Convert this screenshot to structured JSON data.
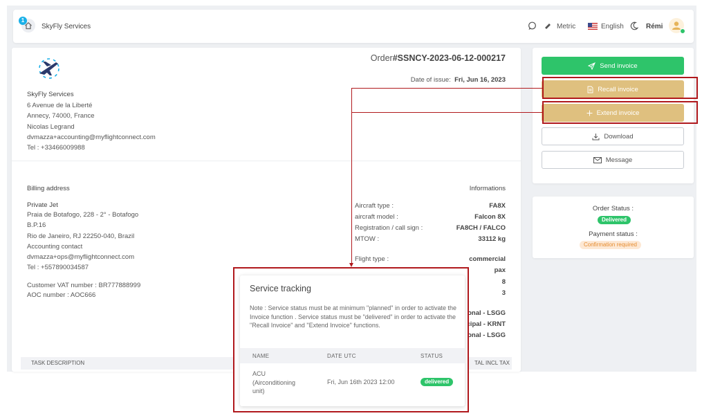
{
  "header": {
    "notification_count": "1",
    "brand": "SkyFly Services",
    "units": "Metric",
    "language": "English",
    "user": "Rémi"
  },
  "order": {
    "prefix": "Order",
    "number": "#SSNCY-2023-06-12-000217",
    "date_label": "Date of issue:",
    "date_value": "Fri, Jun 16, 2023"
  },
  "supplier": {
    "lines": [
      "SkyFly Services",
      "6 Avenue de la Liberté",
      "Annecy,  74000,  France",
      "Nicolas Legrand",
      "dvmazza+accounting@myflightconnect.com",
      "Tel : +33466009988"
    ]
  },
  "billing": {
    "heading": "Billing address",
    "lines": [
      "Private Jet",
      "Praia de Botafogo, 228 - 2° - Botafogo",
      "B.P.16",
      "Rio de Janeiro,  RJ 22250-040,  Brazil",
      "Accounting contact",
      "dvmazza+ops@myflightconnect.com",
      "Tel : +557890034587"
    ],
    "vat": "Customer VAT number : BR777888999",
    "aoc": "AOC number : AOC666"
  },
  "informations": {
    "heading": "Informations",
    "rows": [
      {
        "label": "Aircraft type :",
        "value": "FA8X"
      },
      {
        "label": "aircraft model :",
        "value": "Falcon 8X"
      },
      {
        "label": "Registration / call sign :",
        "value": "FA8CH / FALCO"
      },
      {
        "label": "MTOW :",
        "value": "33112 kg"
      },
      {
        "label": "Flight type :",
        "value": "commercial"
      }
    ],
    "partial_values": [
      "pax",
      "8",
      "3",
      "onal - LSGG",
      "cipal - KRNT",
      "onal - LSGG"
    ]
  },
  "table": {
    "col_task": "TASK DESCRIPTION",
    "col_total": "TAL INCL TAX"
  },
  "actions": {
    "send": "Send invoice",
    "recall": "Recall invoice",
    "extend": "Extend invoice",
    "download": "Download",
    "message": "Message"
  },
  "status": {
    "order_label": "Order Status :",
    "order_value": "Delivered",
    "payment_label": "Payment status :",
    "payment_value": "Confirmation required"
  },
  "popup": {
    "title": "Service tracking",
    "note": "Note : Service status must be at minimum \"planned\" in order to activate the Invoice function . Service status must be \"delivered\" in order to activate the \"Recall Invoice\" and \"Extend Invoice\" functions.",
    "columns": [
      "NAME",
      "DATE UTC",
      "STATUS"
    ],
    "row": {
      "name_lines": [
        "ACU",
        "(Airconditioning",
        "unit)"
      ],
      "date": "Fri, Jun 16th 2023 12:00",
      "status": "delivered"
    }
  },
  "colors": {
    "primary_green": "#2ec46a",
    "gold": "#dfc07f",
    "annotation_red": "#b0181c",
    "brand_blue": "#1ab0e8"
  }
}
